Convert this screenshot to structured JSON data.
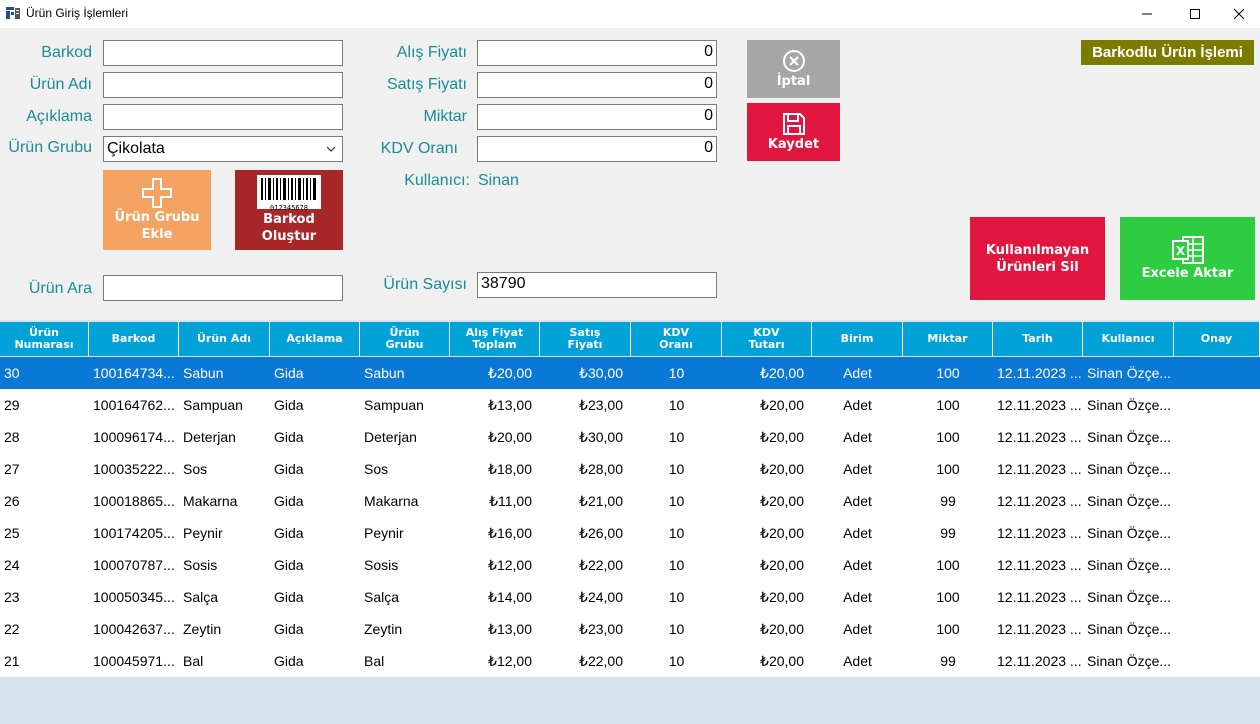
{
  "window": {
    "title": "Ürün Giriş İşlemleri"
  },
  "form": {
    "barkod_label": "Barkod",
    "barkod_value": "",
    "urun_adi_label": "Ürün Adı",
    "urun_adi_value": "",
    "aciklama_label": "Açıklama",
    "aciklama_value": "",
    "urun_grubu_label": "Ürün Grubu",
    "urun_grubu_value": "Çikolata",
    "alis_fiyati_label": "Alış Fiyatı",
    "alis_fiyati_value": "0",
    "satis_fiyati_label": "Satış Fiyatı",
    "satis_fiyati_value": "0",
    "miktar_label": "Miktar",
    "miktar_value": "0",
    "kdv_orani_label": "KDV Oranı",
    "kdv_orani_value": "0",
    "kullanici_label": "Kullanıcı:",
    "kullanici_value": "Sinan",
    "urun_ara_label": "Ürün Ara",
    "urun_ara_value": "",
    "urun_sayisi_label": "Ürün Sayısı",
    "urun_sayisi_value": "38790"
  },
  "buttons": {
    "urun_grubu_ekle_line1": "Ürün Grubu",
    "urun_grubu_ekle_line2": "Ekle",
    "barkod_olustur_line1": "Barkod",
    "barkod_olustur_line2": "Oluştur",
    "barcode_caption": "012345678",
    "iptal": "İptal",
    "kaydet": "Kaydet",
    "barkodlu_urun_islemi": "Barkodlu Ürün İşlemi",
    "kullanilmayan_line1": "Kullanılmayan",
    "kullanilmayan_line2": "Ürünleri Sil",
    "excele_aktar": "Excele Aktar",
    "excel_glyph": "X"
  },
  "colors": {
    "label_teal": "#1a8a9a",
    "iptal_gray": "#a6a6a6",
    "kaydet_red": "#e0163f",
    "urun_grubu_orange": "#f4a261",
    "barkod_dark_red": "#a8282a",
    "barkodlu_olive": "#7b7b00",
    "sil_red": "#e0163f",
    "excel_green": "#2ecc40",
    "grid_header": "#00a2d8",
    "row_selected": "#0a78d7"
  },
  "grid": {
    "columns": [
      {
        "line1": "Ürün",
        "line2": "Numarası"
      },
      {
        "line1": "Barkod",
        "line2": ""
      },
      {
        "line1": "Ürün Adı",
        "line2": ""
      },
      {
        "line1": "Açıklama",
        "line2": ""
      },
      {
        "line1": "Ürün",
        "line2": "Grubu"
      },
      {
        "line1": "Alış Fiyat",
        "line2": "Toplam"
      },
      {
        "line1": "Satış",
        "line2": "Fiyatı"
      },
      {
        "line1": "KDV",
        "line2": "Oranı"
      },
      {
        "line1": "KDV",
        "line2": "Tutarı"
      },
      {
        "line1": "Birim",
        "line2": ""
      },
      {
        "line1": "Miktar",
        "line2": ""
      },
      {
        "line1": "Tarih",
        "line2": ""
      },
      {
        "line1": "Kullanıcı",
        "line2": ""
      },
      {
        "line1": "Onay",
        "line2": ""
      }
    ],
    "rows": [
      [
        "30",
        "100164734...",
        "Sabun",
        "Gida",
        "Sabun",
        "₺20,00",
        "₺30,00",
        "10",
        "₺20,00",
        "Adet",
        "100",
        "12.11.2023 ...",
        "Sinan Özçe...",
        ""
      ],
      [
        "29",
        "100164762...",
        "Sampuan",
        "Gida",
        "Sampuan",
        "₺13,00",
        "₺23,00",
        "10",
        "₺20,00",
        "Adet",
        "100",
        "12.11.2023 ...",
        "Sinan Özçe...",
        ""
      ],
      [
        "28",
        "100096174...",
        "Deterjan",
        "Gida",
        "Deterjan",
        "₺20,00",
        "₺30,00",
        "10",
        "₺20,00",
        "Adet",
        "100",
        "12.11.2023 ...",
        "Sinan Özçe...",
        ""
      ],
      [
        "27",
        "100035222...",
        "Sos",
        "Gida",
        "Sos",
        "₺18,00",
        "₺28,00",
        "10",
        "₺20,00",
        "Adet",
        "100",
        "12.11.2023 ...",
        "Sinan Özçe...",
        ""
      ],
      [
        "26",
        "100018865...",
        "Makarna",
        "Gida",
        "Makarna",
        "₺11,00",
        "₺21,00",
        "10",
        "₺20,00",
        "Adet",
        "99",
        "12.11.2023 ...",
        "Sinan Özçe...",
        ""
      ],
      [
        "25",
        "100174205...",
        "Peynir",
        "Gida",
        "Peynir",
        "₺16,00",
        "₺26,00",
        "10",
        "₺20,00",
        "Adet",
        "99",
        "12.11.2023 ...",
        "Sinan Özçe...",
        ""
      ],
      [
        "24",
        "100070787...",
        "Sosis",
        "Gida",
        "Sosis",
        "₺12,00",
        "₺22,00",
        "10",
        "₺20,00",
        "Adet",
        "100",
        "12.11.2023 ...",
        "Sinan Özçe...",
        ""
      ],
      [
        "23",
        "100050345...",
        "Salça",
        "Gida",
        "Salça",
        "₺14,00",
        "₺24,00",
        "10",
        "₺20,00",
        "Adet",
        "100",
        "12.11.2023 ...",
        "Sinan Özçe...",
        ""
      ],
      [
        "22",
        "100042637...",
        "Zeytin",
        "Gida",
        "Zeytin",
        "₺13,00",
        "₺23,00",
        "10",
        "₺20,00",
        "Adet",
        "100",
        "12.11.2023 ...",
        "Sinan Özçe...",
        ""
      ],
      [
        "21",
        "100045971...",
        "Bal",
        "Gida",
        "Bal",
        "₺12,00",
        "₺22,00",
        "10",
        "₺20,00",
        "Adet",
        "99",
        "12.11.2023 ...",
        "Sinan Özçe...",
        ""
      ]
    ],
    "selected_row": 0
  }
}
